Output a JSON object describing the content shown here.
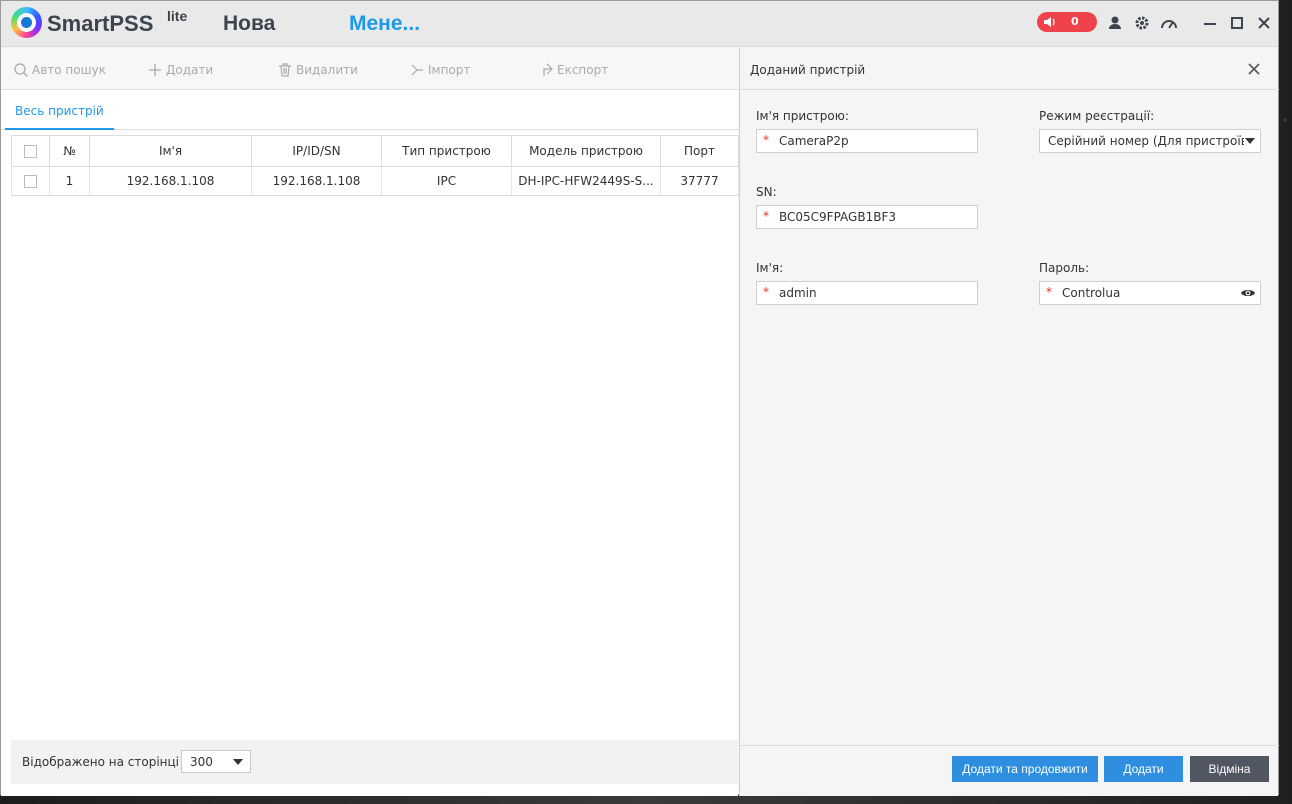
{
  "titlebar": {
    "logo": "SmartPSS",
    "logo_sup": "lite",
    "tabs": [
      {
        "label": "Нова"
      },
      {
        "label": "Мене..."
      }
    ],
    "alarm_count": "0"
  },
  "toolbar": {
    "auto_search": "Авто пошук",
    "add": "Додати",
    "delete": "Видалити",
    "import": "Імпорт",
    "export": "Експорт"
  },
  "subtab": "Весь пристрій",
  "table": {
    "columns": [
      "№",
      "Ім'я",
      "IP/ID/SN",
      "Тип пристрою",
      "Модель пристрою",
      "Порт"
    ],
    "rows": [
      {
        "no": "1",
        "name": "192.168.1.108",
        "ip": "192.168.1.108",
        "type": "IPC",
        "model": "DH-IPC-HFW2449S-S...",
        "port": "37777"
      }
    ]
  },
  "footer": {
    "label": "Відображено на сторінці",
    "per_page": "300"
  },
  "panel": {
    "title": "Доданий пристрій",
    "device_name_label": "Ім'я пристрою:",
    "device_name": "CameraP2p",
    "reg_mode_label": "Режим реєстрації:",
    "reg_mode": "Серійний номер (Для пристроїв, що",
    "sn_label": "SN:",
    "sn": "BC05C9FPAGB1BF3",
    "username_label": "Ім'я:",
    "username": "admin",
    "password_label": "Пароль:",
    "password": "Controlua",
    "required_mark": "*",
    "buttons": {
      "add_continue": "Додати та продовжити",
      "add": "Додати",
      "cancel": "Відміна"
    }
  },
  "colors": {
    "accent": "#1e9ae8",
    "button_primary": "#2e8fe0",
    "button_cancel": "#505662",
    "alarm": "#f0424a"
  }
}
